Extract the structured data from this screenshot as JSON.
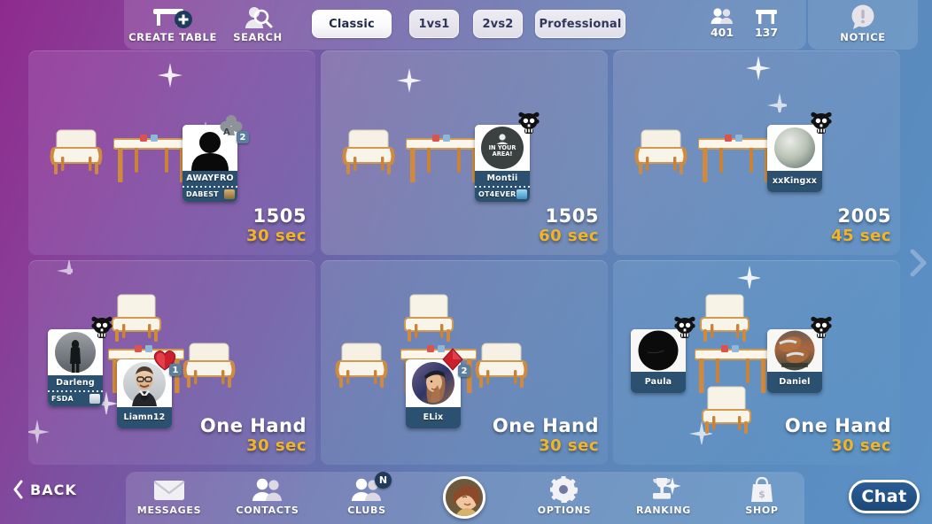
{
  "topbar": {
    "create_table": {
      "label": "CREATE TABLE",
      "icon": "table-plus-icon"
    },
    "search": {
      "label": "SEARCH",
      "icon": "search-person-icon"
    },
    "modes": [
      {
        "label": "Classic",
        "selected": true
      },
      {
        "label": "1vs1",
        "selected": false
      },
      {
        "label": "2vs2",
        "selected": false
      },
      {
        "label": "Professional",
        "selected": false
      }
    ],
    "counters": [
      {
        "name": "players-online",
        "icon": "people-icon",
        "value": "401"
      },
      {
        "name": "tables-open",
        "icon": "table-icon",
        "value": "137"
      }
    ],
    "notice": {
      "label": "NOTICE",
      "icon": "notice-bubble-icon"
    }
  },
  "tables": [
    {
      "id": "table-1",
      "bet": "1505",
      "time": "30 sec",
      "bg": "purple",
      "seats": 2,
      "players": [
        {
          "name": "AWAYFRO",
          "club": "DABEST",
          "club_logo": "#c9a15c",
          "avatar": "silhouette",
          "badge": {
            "suit": "club",
            "count": "2"
          },
          "skull": false
        }
      ]
    },
    {
      "id": "table-2",
      "bet": "1505",
      "time": "60 sec",
      "bg": "grey",
      "seats": 2,
      "players": [
        {
          "name": "Montii",
          "club": "OT4EVER",
          "club_logo": "#6fc4e8",
          "avatar": "in-your-area",
          "avatar_text": "IN YOUR AREA!",
          "badge": null,
          "skull": true
        }
      ]
    },
    {
      "id": "table-3",
      "bet": "2005",
      "time": "45 sec",
      "bg": "blue",
      "seats": 2,
      "players": [
        {
          "name": "xxKingxx",
          "club": null,
          "avatar": "sphere",
          "badge": null,
          "skull": true
        }
      ]
    },
    {
      "id": "table-4",
      "bet": "One Hand",
      "time": "30 sec",
      "bg": "purple2",
      "seats": 4,
      "players": [
        {
          "name": "Darleng",
          "club": "FSDA",
          "club_logo": "#dfe4ea",
          "avatar": "photo-dark",
          "badge": null,
          "skull": true
        },
        {
          "name": "Liamn12",
          "club": null,
          "avatar": "photo-man",
          "badge": {
            "suit": "heart",
            "count": "1"
          },
          "skull": false
        }
      ]
    },
    {
      "id": "table-5",
      "bet": "One Hand",
      "time": "30 sec",
      "bg": "blue2",
      "seats": 4,
      "players": [
        {
          "name": "ELix",
          "club": null,
          "avatar": "photo-woman",
          "badge": {
            "suit": "diamond",
            "count": "2"
          },
          "skull": false
        }
      ]
    },
    {
      "id": "table-6",
      "bet": "One Hand",
      "time": "30 sec",
      "bg": "blue3",
      "seats": 4,
      "players": [
        {
          "name": "Paula",
          "club": null,
          "avatar": "photo-black",
          "badge": null,
          "skull": true
        },
        {
          "name": "Daniel",
          "club": null,
          "avatar": "photo-brown",
          "badge": null,
          "skull": true
        }
      ]
    }
  ],
  "bottombar": {
    "back": {
      "label": "BACK",
      "icon": "chevron-left-icon"
    },
    "items": [
      {
        "name": "messages",
        "label": "MESSAGES",
        "icon": "envelope-icon",
        "badge": null
      },
      {
        "name": "contacts",
        "label": "CONTACTS",
        "icon": "people-icon",
        "badge": null
      },
      {
        "name": "clubs",
        "label": "CLUBS",
        "icon": "people-icon",
        "badge": "N"
      },
      {
        "name": "options",
        "label": "OPTIONS",
        "icon": "gear-icon",
        "badge": null
      },
      {
        "name": "ranking",
        "label": "RANKING",
        "icon": "trophy-icon",
        "badge": null
      },
      {
        "name": "shop",
        "label": "SHOP",
        "icon": "shopping-bag-icon",
        "badge": null
      }
    ],
    "chat": {
      "label": "Chat"
    },
    "profile_avatar": "user-photo"
  },
  "colors": {
    "accent_time": "#f0b429",
    "name_band": "#2b5070",
    "bg_left": "#8e2a8e",
    "bg_right": "#5d92c6"
  }
}
